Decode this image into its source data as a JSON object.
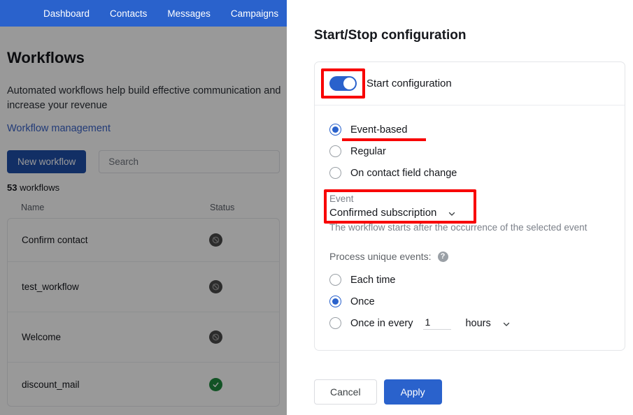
{
  "background_app": {
    "nav": {
      "items": [
        {
          "label": "Dashboard"
        },
        {
          "label": "Contacts"
        },
        {
          "label": "Messages"
        },
        {
          "label": "Campaigns"
        }
      ],
      "background_color": "#2a62cc"
    },
    "page": {
      "title": "Workflows",
      "description": "Automated workflows help build effective communication and increase your revenue",
      "link": "Workflow management",
      "new_button": "New workflow",
      "search_placeholder": "Search",
      "count_number": "53",
      "count_word": "workflows"
    },
    "table": {
      "columns": {
        "name": "Name",
        "status": "Status"
      },
      "rows": [
        {
          "name": "Confirm contact",
          "status": "paused"
        },
        {
          "name": "test_workflow",
          "status": "paused"
        },
        {
          "name": "Welcome",
          "status": "paused"
        },
        {
          "name": "discount_mail",
          "status": "active"
        }
      ]
    }
  },
  "modal": {
    "title": "Start/Stop configuration",
    "start_toggle": {
      "label": "Start configuration",
      "on": true,
      "annotated": true
    },
    "trigger_type": {
      "options": [
        {
          "label": "Event-based",
          "selected": true,
          "annotated": true
        },
        {
          "label": "Regular",
          "selected": false,
          "annotated": false
        },
        {
          "label": "On contact field change",
          "selected": false,
          "annotated": false
        }
      ]
    },
    "event_field": {
      "label": "Event",
      "value": "Confirmed subscription",
      "hint": "The workflow starts after the occurrence of the selected event",
      "annotated": true
    },
    "process_unique": {
      "label": "Process unique events:",
      "help_icon_glyph": "?",
      "options": [
        {
          "label": "Each time",
          "selected": false
        },
        {
          "label": "Once",
          "selected": true
        },
        {
          "label": "Once in every",
          "selected": false
        }
      ],
      "interval_value": "1",
      "interval_unit": "hours"
    },
    "footer": {
      "cancel_label": "Cancel",
      "apply_label": "Apply"
    }
  },
  "annotation_color": "#f80000"
}
